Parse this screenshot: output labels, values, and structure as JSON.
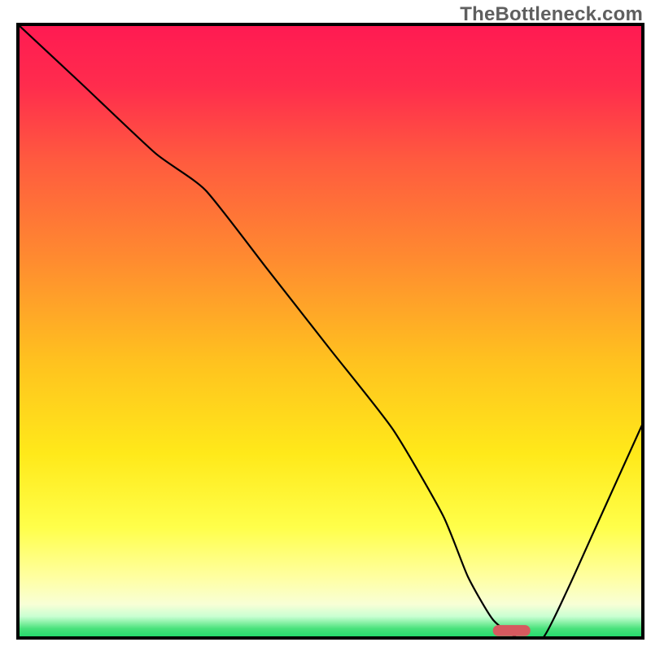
{
  "watermark": "TheBottleneck.com",
  "chart_data": {
    "type": "line",
    "title": "",
    "xlabel": "",
    "ylabel": "",
    "xlim": [
      0,
      100
    ],
    "ylim": [
      0,
      100
    ],
    "grid": false,
    "legend": false,
    "background": {
      "type": "vertical-gradient",
      "stops": [
        {
          "pos": 0.0,
          "color": "#ff1a52"
        },
        {
          "pos": 0.1,
          "color": "#ff2c4d"
        },
        {
          "pos": 0.22,
          "color": "#ff5a3f"
        },
        {
          "pos": 0.38,
          "color": "#ff8a30"
        },
        {
          "pos": 0.55,
          "color": "#ffc21f"
        },
        {
          "pos": 0.7,
          "color": "#ffe91a"
        },
        {
          "pos": 0.82,
          "color": "#ffff4a"
        },
        {
          "pos": 0.9,
          "color": "#ffffa0"
        },
        {
          "pos": 0.945,
          "color": "#f8ffd6"
        },
        {
          "pos": 0.965,
          "color": "#c9ffd2"
        },
        {
          "pos": 0.985,
          "color": "#48e27b"
        },
        {
          "pos": 1.0,
          "color": "#1fd86b"
        }
      ]
    },
    "series": [
      {
        "name": "bottleneck-curve",
        "x": [
          0,
          10,
          22,
          30,
          40,
          50,
          60,
          68,
          72,
          76,
          80,
          84,
          88,
          92,
          96,
          100
        ],
        "y": [
          100,
          90.5,
          79,
          73,
          60,
          47,
          34,
          20,
          10,
          3,
          0,
          0,
          8,
          17,
          26,
          35
        ]
      }
    ],
    "marker": {
      "name": "optimal-point",
      "x": 79,
      "y": 1.2,
      "width": 6,
      "height": 1.8,
      "color": "#d65a5f"
    },
    "frame": {
      "stroke": "#000000",
      "stroke_width": 4
    }
  }
}
